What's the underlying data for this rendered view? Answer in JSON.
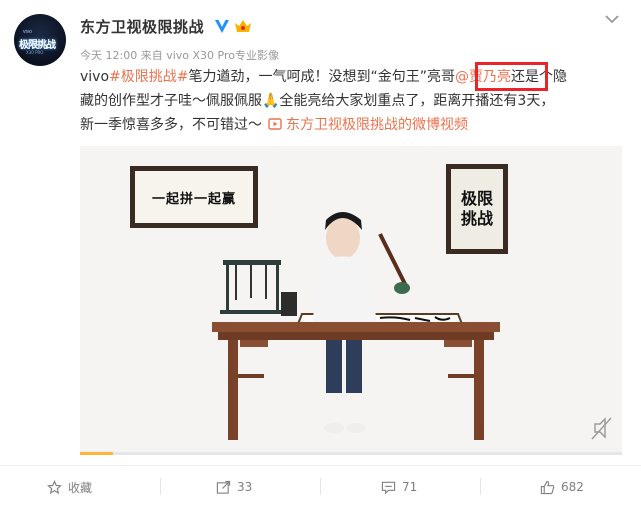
{
  "account": {
    "name": "东方卫视极限挑战",
    "avatar_badge_top": "vivo",
    "avatar_badge_main": "极限挑战",
    "avatar_badge_sub": "X30 PRO",
    "verified_icon": "verified-v-icon",
    "vip_icon": "vip-crown-icon"
  },
  "meta": {
    "text": "今天 12:00 来自 vivo X30 Pro专业影像"
  },
  "post": {
    "brand": "vivo",
    "hashtag": "#极限挑战#",
    "line1_after_tag": "笔力遒劲，一气呵成！没想到“金句王”亮哥",
    "mention": "@贾乃亮",
    "line1_tail": "还是个隐",
    "line2": "藏的创作型才子哇～佩服佩服🙏全能亮给大家划重点了，距离开播还有3天，",
    "line3": "新一季惊喜多多，不可错过～",
    "video_link": "东方卫视极限挑战的微博视频",
    "highlight_color": "#e8262a",
    "link_color": "#eb7350"
  },
  "video": {
    "left_calligraphy": "一起拼一起赢",
    "right_calligraphy": "极限挑战",
    "progress_fraction": 0.06,
    "progress_color": "#ffb43c"
  },
  "actions": {
    "favorite_label": "收藏",
    "repost_count": "33",
    "comment_count": "71",
    "like_count": "682",
    "icons": [
      "star-icon",
      "share-icon",
      "comment-icon",
      "like-icon"
    ]
  }
}
